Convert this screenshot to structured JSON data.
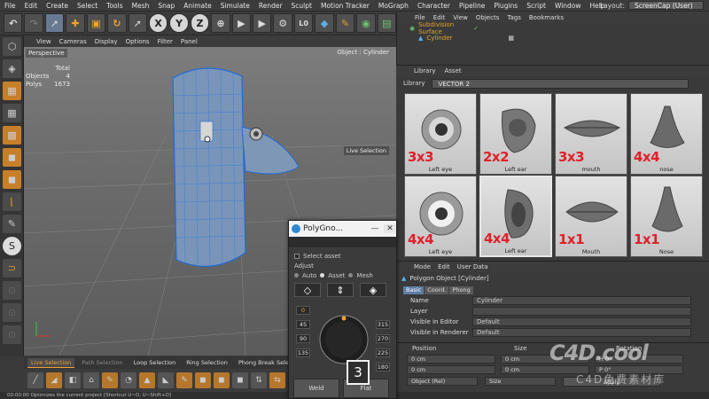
{
  "menubar": {
    "items": [
      "File",
      "Edit",
      "Create",
      "Select",
      "Tools",
      "Mesh",
      "Snap",
      "Animate",
      "Simulate",
      "Render",
      "Sculpt",
      "Motion Tracker",
      "MoGraph",
      "Character",
      "Pipeline",
      "Plugins",
      "Script",
      "Window",
      "Help"
    ],
    "layout_label": "Layout:",
    "layout_value": "ScreenCap (User)"
  },
  "toolbar": {
    "axis_x": "X",
    "axis_y": "Y",
    "axis_z": "Z",
    "l0": "L0"
  },
  "viewport": {
    "menu": [
      "View",
      "Cameras",
      "Display",
      "Options",
      "Filter",
      "Panel"
    ],
    "title": "Perspective",
    "object_label": "Object : Cylinder",
    "stats_header": "Total",
    "stats": [
      {
        "k": "Objects",
        "v": "4"
      },
      {
        "k": "Polys",
        "v": "1673"
      }
    ],
    "live_selection_tag": "Live Selection"
  },
  "bottom_tabs": [
    "Live Selection",
    "Path Selection",
    "Loop Selection",
    "Ring Selection",
    "Phong Break Selection"
  ],
  "status_text": "00:00:00    Optimizes the current project [Shortcut U~O, U~Shift+O]",
  "object_manager": {
    "menu": [
      "File",
      "Edit",
      "View",
      "Objects",
      "Tags",
      "Bookmarks"
    ],
    "items": [
      "Subdivision Surface",
      "Cylinder"
    ]
  },
  "library": {
    "menu": [
      "Library",
      "Asset"
    ],
    "label": "Library",
    "selected": "VECTOR 2",
    "tiles": [
      {
        "count": "3x3",
        "label": "Left eye"
      },
      {
        "count": "2x2",
        "label": "Left ear"
      },
      {
        "count": "3x3",
        "label": "mouth"
      },
      {
        "count": "4x4",
        "label": "nose"
      },
      {
        "count": "4x4",
        "label": "Left eye"
      },
      {
        "count": "4x4",
        "label": "Left ear"
      },
      {
        "count": "1x1",
        "label": "Mouth"
      },
      {
        "count": "1x1",
        "label": "Nose"
      }
    ]
  },
  "attributes": {
    "menu": [
      "Mode",
      "Edit",
      "User Data"
    ],
    "title": "Polygon Object [Cylinder]",
    "tabs": [
      "Basic",
      "Coord.",
      "Phong"
    ],
    "rows": [
      {
        "k": "Name",
        "v": "Cylinder"
      },
      {
        "k": "Layer",
        "v": ""
      },
      {
        "k": "Visible in Editor",
        "v": "Default"
      },
      {
        "k": "Visible in Renderer",
        "v": "Default"
      }
    ]
  },
  "coordinates": {
    "headers": [
      "Position",
      "Size",
      "Rotation"
    ],
    "rows": [
      [
        "0 cm",
        "0 cm",
        "H 0°"
      ],
      [
        "0 cm",
        "0 cm",
        "P 0°"
      ],
      [
        "0 cm",
        "0 cm",
        "B 0°"
      ]
    ],
    "mode": "Object (Rel)",
    "size_mode": "Size",
    "apply": "Apply"
  },
  "polygnome": {
    "title": "PolyGno...",
    "select_asset": "Select asset",
    "adjust": "Adjust",
    "modes": [
      "Auto",
      "Asset",
      "Mesh"
    ],
    "active_mode": "Asset",
    "angles": {
      "top": "0",
      "l1": "45",
      "l2": "90",
      "l3": "135",
      "r1": "315",
      "r2": "270",
      "r3": "225",
      "r4": "180"
    },
    "weld": "Weld",
    "flat": "Flat"
  },
  "key_overlay": "3",
  "watermark": {
    "line1": "C4D.cool",
    "line2": "C4D免费素材库"
  }
}
